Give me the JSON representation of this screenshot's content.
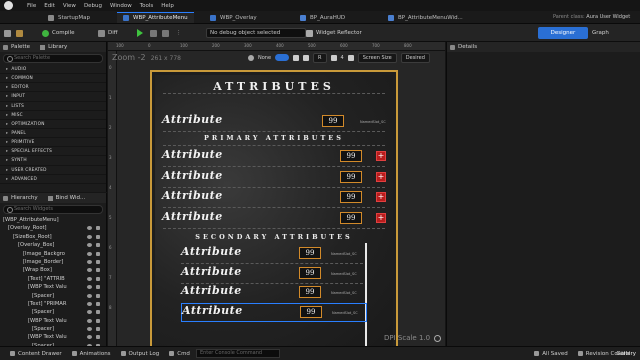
{
  "menu": {
    "items": [
      "File",
      "Edit",
      "View",
      "Debug",
      "Window",
      "Tools",
      "Help"
    ]
  },
  "tabs": [
    {
      "label": "StartupMap"
    },
    {
      "label": "WBP_AttributeMenu"
    },
    {
      "label": "WBP_Overlay"
    },
    {
      "label": "BP_AuraHUD"
    },
    {
      "label": "BP_AttributeMenuWid..."
    }
  ],
  "parent_class": {
    "label": "Parent class:",
    "value": "Aura User Widget"
  },
  "toolbar": {
    "compile": "Compile",
    "diff": "Diff",
    "debug_object": "No debug object selected",
    "widget_reflector": "Widget Reflector",
    "designer": "Designer",
    "graph": "Graph"
  },
  "palette": {
    "tab1": "Palette",
    "tab2": "Library",
    "search_placeholder": "Search Palette",
    "categories": [
      "AUDIO",
      "COMMON",
      "EDITOR",
      "INPUT",
      "LISTS",
      "MISC",
      "OPTIMIZATION",
      "PANEL",
      "PRIMITIVE",
      "SPECIAL EFFECTS",
      "SYNTH",
      "USER CREATED",
      "ADVANCED"
    ]
  },
  "hierarchy": {
    "tab1": "Hierarchy",
    "tab2": "Bind Wid...",
    "search_placeholder": "Search Widgets",
    "items": [
      "[WBP_AttributeMenu]",
      "[Overlay_Root]",
      "[SizeBox_Root]",
      "[Overlay_Box]",
      "[Image_Backgro",
      "[Image_Border]",
      "[Wrap Box]",
      "[Text] \"ATTRIB",
      "[WBP Text Valu",
      "[Spacer]",
      "[Text] \"PRIMAR",
      "[Spacer]",
      "[WBP Text Valu",
      "[Spacer]",
      "[WBP Text Valu",
      "[Spacer]"
    ]
  },
  "canvas": {
    "zoom": "Zoom -2",
    "size": "261 x 778",
    "none": "None",
    "r": "R",
    "num": "4",
    "screen_size": "Screen Size",
    "desired": "Desired",
    "dpi_scale": "DPI Scale 1.0"
  },
  "widget": {
    "title": "ATTRIBUTES",
    "primary_heading": "PRIMARY ATTRIBUTES",
    "secondary_heading": "SECONDARY ATTRIBUTES",
    "attr_label": "Attribute",
    "value": "99",
    "plus": "+",
    "named_slot": "NamedSlot_SC"
  },
  "details": {
    "tab": "Details"
  },
  "status": {
    "content_drawer": "Content Drawer",
    "animations": "Animations",
    "output_log": "Output Log",
    "cmd": "Cmd",
    "console_placeholder": "Enter Console Command",
    "all_saved": "All Saved",
    "revision_control": "Revision Control",
    "gallery": "Gallery"
  }
}
